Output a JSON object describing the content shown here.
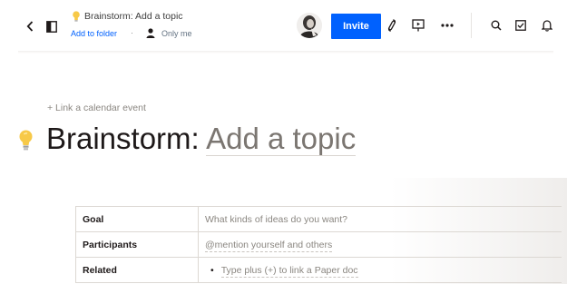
{
  "header": {
    "doc_title": "Brainstorm: Add a topic",
    "add_to_folder": "Add to folder",
    "separator": "·",
    "sharing": "Only me",
    "invite_label": "Invite"
  },
  "document": {
    "calendar_link": "+ Link a calendar event",
    "title_prefix": "Brainstorm:",
    "title_placeholder": "Add a topic",
    "emoji": "lightbulb-icon",
    "table": {
      "rows": [
        {
          "label": "Goal",
          "value": "What kinds of ideas do you want?"
        },
        {
          "label": "Participants",
          "value": "@mention yourself and others"
        },
        {
          "label": "Related",
          "value": "Type plus (+) to link a Paper doc"
        }
      ]
    }
  },
  "colors": {
    "accent": "#0061fe",
    "text": "#1e1919",
    "muted": "#8a8680",
    "bulb": "#f7c948"
  }
}
